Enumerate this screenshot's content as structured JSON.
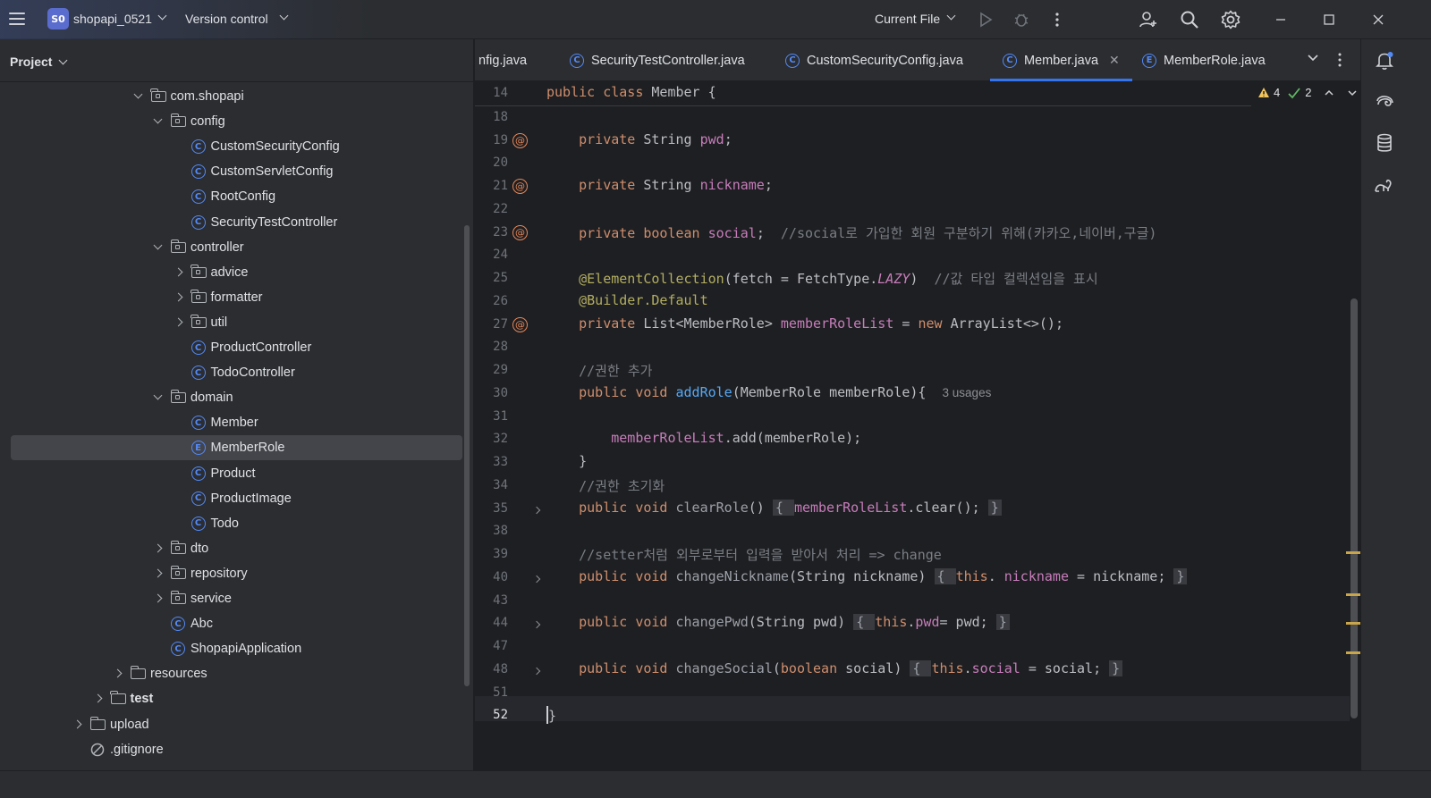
{
  "titlebar": {
    "project_badge": "S0",
    "project_name": "shopapi_0521",
    "version_control": "Version control",
    "run_config": "Current File"
  },
  "project_panel": {
    "title": "Project",
    "tree": [
      {
        "label": "com.shopapi",
        "kind": "package",
        "level": 5,
        "state": "open"
      },
      {
        "label": "config",
        "kind": "package",
        "level": 6,
        "state": "open"
      },
      {
        "label": "CustomSecurityConfig",
        "kind": "class",
        "level": 7
      },
      {
        "label": "CustomServletConfig",
        "kind": "class",
        "level": 7
      },
      {
        "label": "RootConfig",
        "kind": "class",
        "level": 7
      },
      {
        "label": "SecurityTestController",
        "kind": "class",
        "level": 7
      },
      {
        "label": "controller",
        "kind": "package",
        "level": 6,
        "state": "open"
      },
      {
        "label": "advice",
        "kind": "package",
        "level": 7,
        "state": "closed"
      },
      {
        "label": "formatter",
        "kind": "package",
        "level": 7,
        "state": "closed"
      },
      {
        "label": "util",
        "kind": "package",
        "level": 7,
        "state": "closed"
      },
      {
        "label": "ProductController",
        "kind": "class",
        "level": 7
      },
      {
        "label": "TodoController",
        "kind": "class",
        "level": 7
      },
      {
        "label": "domain",
        "kind": "package",
        "level": 6,
        "state": "open"
      },
      {
        "label": "Member",
        "kind": "class",
        "level": 7
      },
      {
        "label": "MemberRole",
        "kind": "enum",
        "level": 7,
        "selected": true
      },
      {
        "label": "Product",
        "kind": "class",
        "level": 7
      },
      {
        "label": "ProductImage",
        "kind": "class",
        "level": 7
      },
      {
        "label": "Todo",
        "kind": "class",
        "level": 7
      },
      {
        "label": "dto",
        "kind": "package",
        "level": 6,
        "state": "closed"
      },
      {
        "label": "repository",
        "kind": "package",
        "level": 6,
        "state": "closed"
      },
      {
        "label": "service",
        "kind": "package",
        "level": 6,
        "state": "closed"
      },
      {
        "label": "Abc",
        "kind": "class",
        "level": 6
      },
      {
        "label": "ShopapiApplication",
        "kind": "class",
        "level": 6
      },
      {
        "label": "resources",
        "kind": "folder",
        "level": 4,
        "state": "closed"
      },
      {
        "label": "test",
        "kind": "folder",
        "level": 3,
        "state": "closed",
        "bold": true
      },
      {
        "label": "upload",
        "kind": "folder",
        "level": 2,
        "state": "closed"
      },
      {
        "label": ".gitignore",
        "kind": "ignore",
        "level": 2
      }
    ]
  },
  "tabs": [
    {
      "label": "nfig.java",
      "icon": false
    },
    {
      "label": "SecurityTestController.java",
      "icon": "C"
    },
    {
      "label": "CustomSecurityConfig.java",
      "icon": "C"
    },
    {
      "label": "Member.java",
      "icon": "C",
      "active": true
    },
    {
      "label": "MemberRole.java",
      "icon": "E"
    }
  ],
  "inspections": {
    "warnings": "4",
    "weak_warnings": "2"
  },
  "code": {
    "lines": [
      {
        "n": "14",
        "sticky": true,
        "tokens": [
          [
            "kw",
            "public class "
          ],
          [
            "",
            "Member "
          ],
          [
            "",
            "{"
          ]
        ]
      },
      {
        "n": "18",
        "tokens": []
      },
      {
        "n": "19",
        "at": true,
        "tokens": [
          [
            "",
            "    "
          ],
          [
            "kw",
            "private "
          ],
          [
            "",
            "String "
          ],
          [
            "fld",
            "pwd"
          ],
          [
            "",
            ";"
          ]
        ]
      },
      {
        "n": "20",
        "tokens": []
      },
      {
        "n": "21",
        "at": true,
        "tokens": [
          [
            "",
            "    "
          ],
          [
            "kw",
            "private "
          ],
          [
            "",
            "String "
          ],
          [
            "fld",
            "nickname"
          ],
          [
            "",
            ";"
          ]
        ]
      },
      {
        "n": "22",
        "tokens": []
      },
      {
        "n": "23",
        "at": true,
        "tokens": [
          [
            "",
            "    "
          ],
          [
            "kw",
            "private boolean "
          ],
          [
            "fld",
            "social"
          ],
          [
            "",
            ";  "
          ],
          [
            "cm",
            "//social로 가입한 회원 구분하기 위해(카카오,네이버,구글)"
          ]
        ]
      },
      {
        "n": "24",
        "tokens": []
      },
      {
        "n": "25",
        "tokens": [
          [
            "",
            "    "
          ],
          [
            "ann",
            "@ElementCollection"
          ],
          [
            "",
            "(fetch = FetchType."
          ],
          [
            "it",
            "LAZY"
          ],
          [
            "",
            ")  "
          ],
          [
            "cm",
            "//값 타입 컬렉션임을 표시"
          ]
        ]
      },
      {
        "n": "26",
        "tokens": [
          [
            "",
            "    "
          ],
          [
            "ann",
            "@Builder.Default"
          ]
        ]
      },
      {
        "n": "27",
        "at": true,
        "tokens": [
          [
            "",
            "    "
          ],
          [
            "kw",
            "private "
          ],
          [
            "",
            "List<MemberRole> "
          ],
          [
            "fld",
            "memberRoleList"
          ],
          [
            "",
            " = "
          ],
          [
            "kw",
            "new "
          ],
          [
            "",
            "ArrayList<>();"
          ]
        ]
      },
      {
        "n": "28",
        "tokens": []
      },
      {
        "n": "29",
        "tokens": [
          [
            "",
            "    "
          ],
          [
            "cm",
            "//권한 추가"
          ]
        ]
      },
      {
        "n": "30",
        "tokens": [
          [
            "",
            "    "
          ],
          [
            "kw",
            "public void "
          ],
          [
            "fn",
            "addRole"
          ],
          [
            "",
            "(MemberRole memberRole){  "
          ],
          [
            "hint",
            "3 usages"
          ]
        ]
      },
      {
        "n": "31",
        "tokens": []
      },
      {
        "n": "32",
        "tokens": [
          [
            "",
            "        "
          ],
          [
            "fld",
            "memberRoleList"
          ],
          [
            "",
            ".add(memberRole);"
          ]
        ]
      },
      {
        "n": "33",
        "tokens": [
          [
            "",
            "    }"
          ]
        ]
      },
      {
        "n": "34",
        "tokens": [
          [
            "",
            "    "
          ],
          [
            "cm",
            "//권한 초기화"
          ]
        ]
      },
      {
        "n": "35",
        "fold": true,
        "tokens": [
          [
            "",
            "    "
          ],
          [
            "kw",
            "public void "
          ],
          [
            "mut",
            "clearRole"
          ],
          [
            "",
            "() "
          ],
          [
            "fold-box",
            "{ "
          ],
          [
            "fld",
            "memberRoleList"
          ],
          [
            "",
            ".clear(); "
          ],
          [
            "fold-box",
            "}"
          ]
        ]
      },
      {
        "n": "38",
        "tokens": []
      },
      {
        "n": "39",
        "tokens": [
          [
            "",
            "    "
          ],
          [
            "cm",
            "//setter처럼 외부로부터 입력을 받아서 처리 => change"
          ]
        ]
      },
      {
        "n": "40",
        "fold": true,
        "tokens": [
          [
            "",
            "    "
          ],
          [
            "kw",
            "public void "
          ],
          [
            "mut",
            "changeNickname"
          ],
          [
            "",
            "(String nickname) "
          ],
          [
            "fold-box",
            "{ "
          ],
          [
            "kw",
            "this"
          ],
          [
            "",
            ". "
          ],
          [
            "fld",
            "nickname"
          ],
          [
            "",
            " = nickname; "
          ],
          [
            "fold-box",
            "}"
          ]
        ]
      },
      {
        "n": "43",
        "tokens": []
      },
      {
        "n": "44",
        "fold": true,
        "tokens": [
          [
            "",
            "    "
          ],
          [
            "kw",
            "public void "
          ],
          [
            "mut",
            "changePwd"
          ],
          [
            "",
            "(String pwd) "
          ],
          [
            "fold-box",
            "{ "
          ],
          [
            "kw",
            "this"
          ],
          [
            "",
            "."
          ],
          [
            "fld",
            "pwd"
          ],
          [
            "",
            "= pwd; "
          ],
          [
            "fold-box",
            "}"
          ]
        ]
      },
      {
        "n": "47",
        "tokens": []
      },
      {
        "n": "48",
        "fold": true,
        "tokens": [
          [
            "",
            "    "
          ],
          [
            "kw",
            "public void "
          ],
          [
            "mut",
            "changeSocial"
          ],
          [
            "",
            "("
          ],
          [
            "kw",
            "boolean "
          ],
          [
            "",
            "social) "
          ],
          [
            "fold-box",
            "{ "
          ],
          [
            "kw",
            "this"
          ],
          [
            "",
            "."
          ],
          [
            "fld",
            "social"
          ],
          [
            "",
            " = social; "
          ],
          [
            "fold-box",
            "}"
          ]
        ]
      },
      {
        "n": "51",
        "tokens": []
      },
      {
        "n": "52",
        "current": true,
        "tokens": [
          [
            "caret",
            "}"
          ]
        ]
      }
    ]
  },
  "colors": {
    "accent": "#3574f0",
    "keyword": "#cf8e6d",
    "field": "#c77dbb",
    "method": "#56a8f5",
    "comment": "#7a7e85",
    "annotation": "#b3ae60"
  }
}
